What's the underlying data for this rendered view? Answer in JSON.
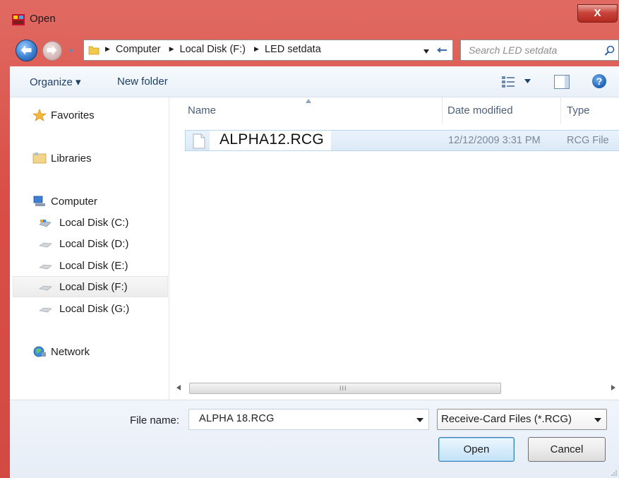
{
  "window": {
    "title": "Open",
    "close_label": "X"
  },
  "address": {
    "breadcrumbs": [
      "Computer",
      "Local Disk (F:)",
      "LED setdata"
    ]
  },
  "search": {
    "placeholder": "Search LED setdata"
  },
  "toolbar": {
    "organize_label": "Organize ▾",
    "new_folder_label": "New folder",
    "help_label": "?"
  },
  "navpane": {
    "favorites": "Favorites",
    "libraries": "Libraries",
    "computer": "Computer",
    "drives": [
      "Local Disk (C:)",
      "Local Disk (D:)",
      "Local Disk (E:)",
      "Local Disk (F:)",
      "Local Disk (G:)"
    ],
    "selected_drive": "Local Disk (F:)",
    "network": "Network"
  },
  "filelist": {
    "columns": [
      "Name",
      "Date modified",
      "Type"
    ],
    "rows": [
      {
        "name": "ALPHA12.RCG",
        "date_modified": "12/12/2009 3:31 PM",
        "type": "RCG File"
      }
    ],
    "hscroll_grip": "III"
  },
  "bottom": {
    "file_name_label": "File name:",
    "file_name_value": "ALPHA 18.RCG",
    "file_type_value": "Receive-Card Files (*.RCG)",
    "open_label": "Open",
    "cancel_label": "Cancel"
  },
  "colors": {
    "frame": "#d94f47",
    "accent": "#1e3f66",
    "selection": "#dbe9f6"
  }
}
